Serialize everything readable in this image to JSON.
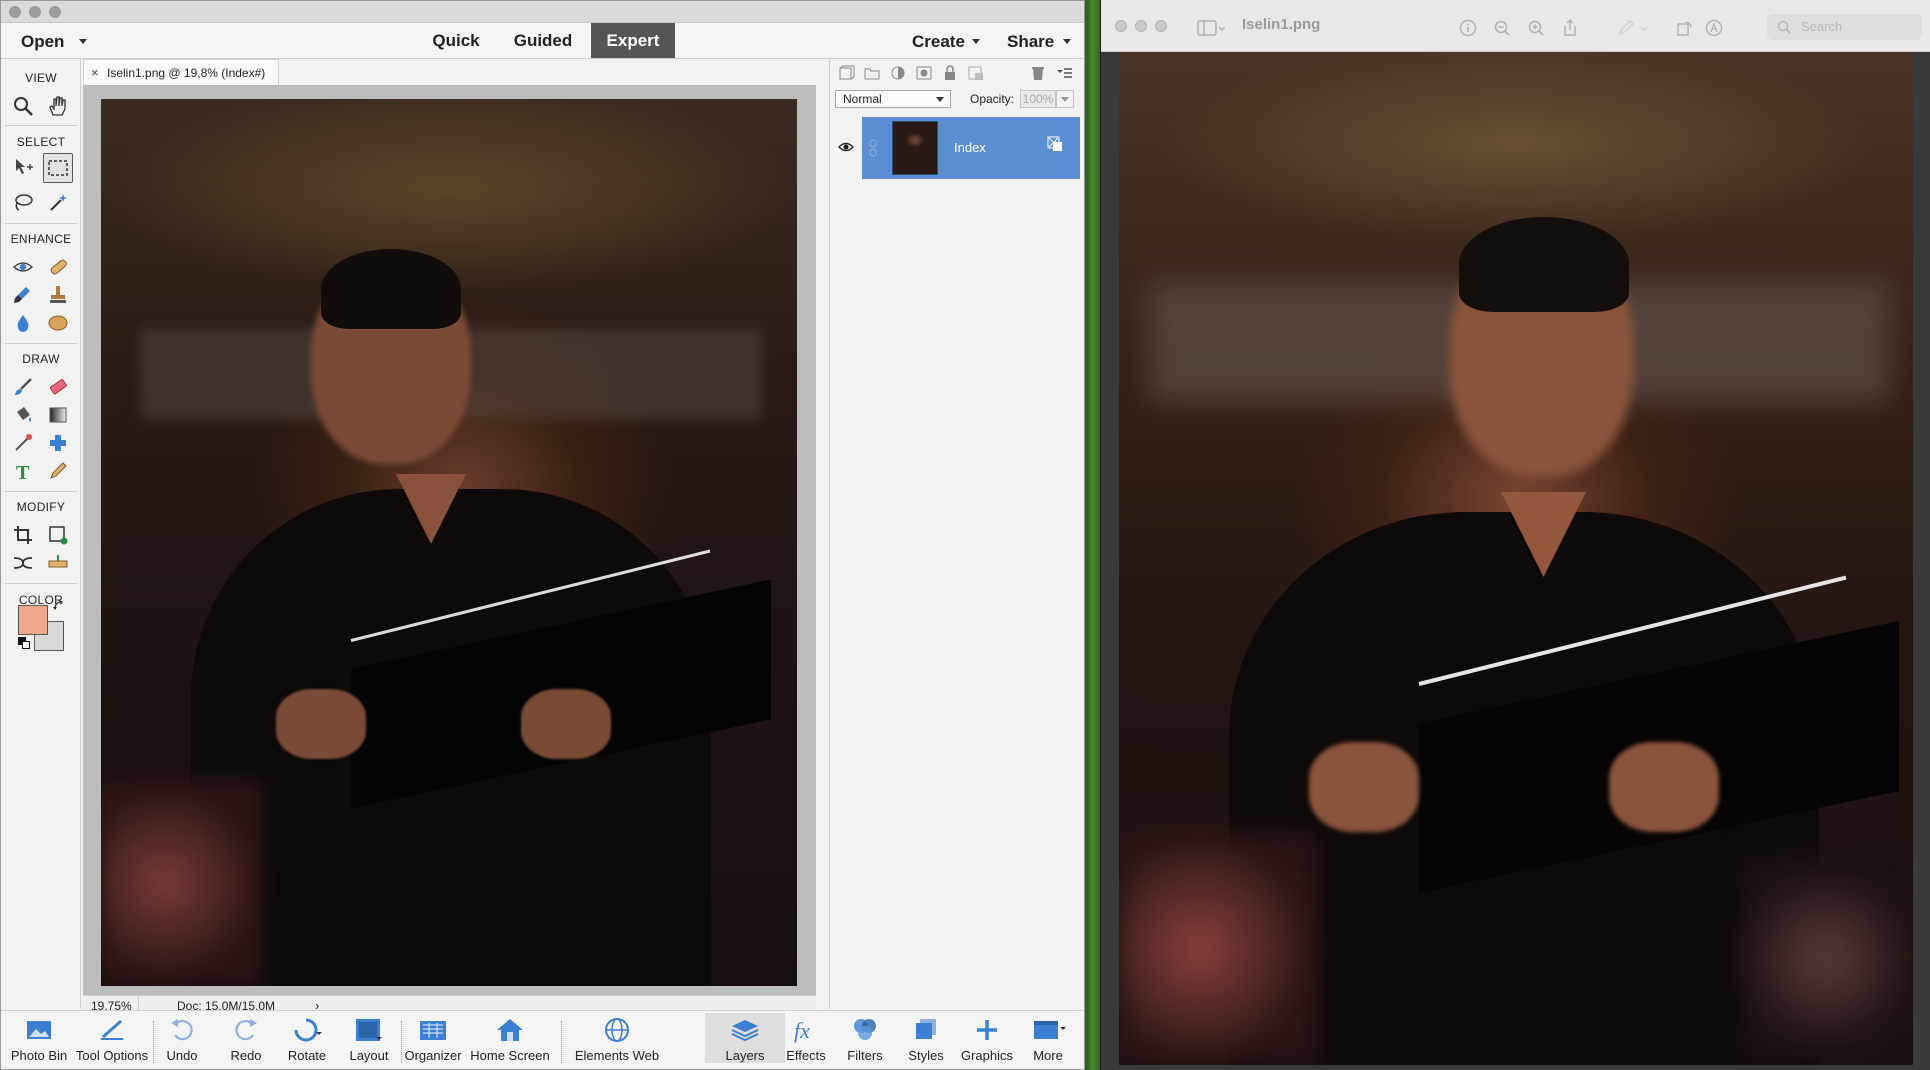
{
  "editor": {
    "menu": {
      "open_label": "Open",
      "create_label": "Create",
      "share_label": "Share"
    },
    "modes": [
      {
        "label": "Quick"
      },
      {
        "label": "Guided"
      },
      {
        "label": "Expert"
      }
    ],
    "toolbox": {
      "view_label": "VIEW",
      "select_label": "SELECT",
      "enhance_label": "ENHANCE",
      "draw_label": "DRAW",
      "modify_label": "MODIFY",
      "color_label": "COLOR",
      "foreground_color": "#f0a88c",
      "background_color": "#d9d9d9"
    },
    "document": {
      "close_glyph": "×",
      "tab_title": "Iselin1.png @ 19,8% (Index#)"
    },
    "status": {
      "zoom": "19,75%",
      "doc_size": "Doc: 15,0M/15,0M",
      "arrow": "›"
    },
    "layers_panel": {
      "blend_mode": "Normal",
      "opacity_label": "Opacity:",
      "opacity_value": "100%",
      "layer_name": "Index"
    },
    "bottom_bar": {
      "photo_bin": "Photo Bin",
      "tool_options": "Tool Options",
      "undo": "Undo",
      "redo": "Redo",
      "rotate": "Rotate",
      "layout": "Layout",
      "organizer": "Organizer",
      "home_screen": "Home Screen",
      "elements_web": "Elements Web",
      "layers": "Layers",
      "effects": "Effects",
      "filters": "Filters",
      "styles": "Styles",
      "graphics": "Graphics",
      "more": "More"
    }
  },
  "preview": {
    "title": "Iselin1.png",
    "search_placeholder": "Search"
  },
  "colors": {
    "accent_selected_layer": "#5a8dd2",
    "active_mode": "#555555",
    "window_green": "#2e6b22"
  }
}
